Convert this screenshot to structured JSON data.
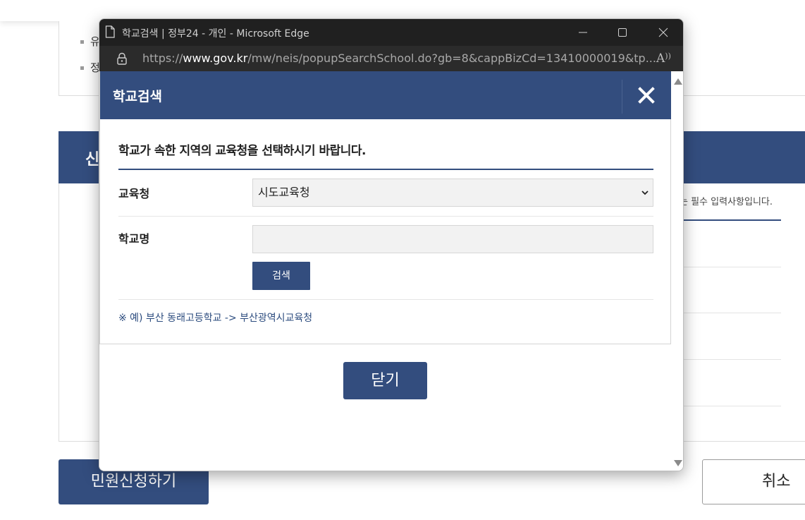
{
  "background": {
    "bullets": [
      "유",
      "정"
    ],
    "section_title": "신",
    "required_note": "는 필수 입력사항입니다.",
    "apply_button": "민원신청하기",
    "cancel_button": "취소"
  },
  "window": {
    "title": "학교검색 | 정부24 - 개인 - Microsoft Edge",
    "url_prefix": "https://",
    "url_domain": "www.gov.kr",
    "url_path": "/mw/neis/popupSearchSchool.do?gb=8&cappBizCd=13410000019&tp..."
  },
  "popup": {
    "title": "학교검색",
    "instruction": "학교가 속한 지역의 교육청을 선택하시기 바랍니다.",
    "office_label": "교육청",
    "office_selected": "시도교육청",
    "school_label": "학교명",
    "school_value": "",
    "search_button": "검색",
    "example": "※ 예) 부산 동래고등학교 -> 부산광역시교육청",
    "close_button": "닫기"
  },
  "colors": {
    "brand_navy": "#334d7e",
    "titlebar": "#202020",
    "addressbar": "#2b2b2b"
  },
  "icons": [
    "page-icon",
    "minimize-icon",
    "maximize-icon",
    "window-close-icon",
    "lock-icon",
    "read-aloud-icon",
    "close-x-icon",
    "chevron-down-icon",
    "scroll-up-arrow",
    "scroll-down-arrow"
  ]
}
